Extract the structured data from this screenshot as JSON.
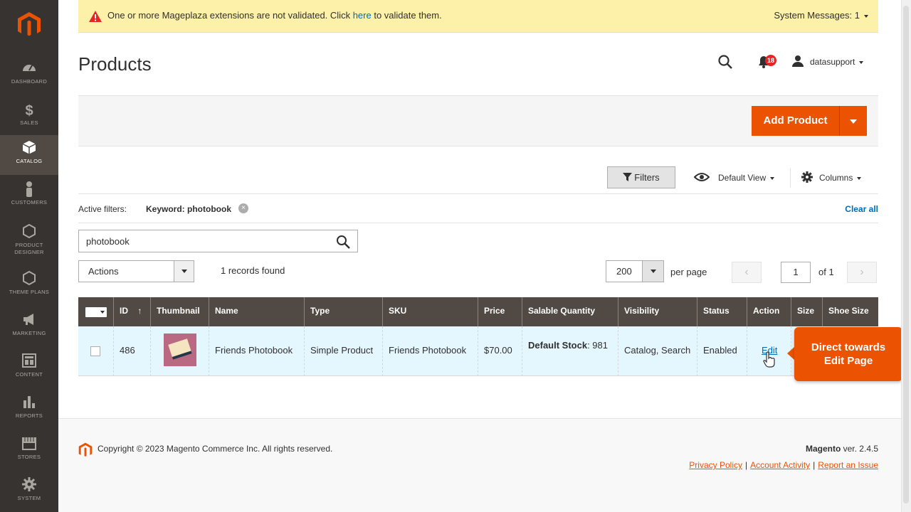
{
  "sidebar": {
    "items": [
      {
        "label": "Dashboard",
        "icon": "dashboard-icon"
      },
      {
        "label": "Sales",
        "icon": "dollar-icon"
      },
      {
        "label": "Catalog",
        "icon": "box-icon"
      },
      {
        "label": "Customers",
        "icon": "person-icon"
      },
      {
        "label": "Product Designer",
        "icon": "hexagon-icon"
      },
      {
        "label": "Theme Plans",
        "icon": "hexagon-icon"
      },
      {
        "label": "Marketing",
        "icon": "megaphone-icon"
      },
      {
        "label": "Content",
        "icon": "layout-icon"
      },
      {
        "label": "Reports",
        "icon": "bar-chart-icon"
      },
      {
        "label": "Stores",
        "icon": "store-icon"
      },
      {
        "label": "System",
        "icon": "gear-icon"
      }
    ],
    "active": "Catalog"
  },
  "system_message": {
    "text_before": "One or more Mageplaza extensions are not validated. Click ",
    "link": "here",
    "text_after": " to validate them.",
    "counter": "System Messages: 1"
  },
  "header": {
    "title": "Products",
    "notifications_count": "18",
    "user": "datasupport"
  },
  "actions": {
    "add_product": "Add Product"
  },
  "toolbar": {
    "filters": "Filters",
    "view": "Default View",
    "columns": "Columns"
  },
  "active_filters": {
    "label": "Active filters:",
    "chip": "Keyword: photobook",
    "remove": "×",
    "clear_all": "Clear all"
  },
  "search": {
    "value": "photobook"
  },
  "mass_actions": "Actions",
  "records_found": "1 records found",
  "pagination": {
    "per_page_value": "200",
    "per_page_label": "per page",
    "prev": "‹",
    "next": "›",
    "current_page": "1",
    "total_pages": "of 1"
  },
  "grid": {
    "columns": [
      "ID",
      "Thumbnail",
      "Name",
      "Type",
      "SKU",
      "Price",
      "Salable Quantity",
      "Visibility",
      "Status",
      "Action",
      "Size",
      "Shoe Size"
    ],
    "sort_indicator": "↑",
    "row": {
      "id": "486",
      "name": "Friends Photobook",
      "type": "Simple Product",
      "sku": "Friends Photobook",
      "price": "$70.00",
      "salable_label": "Default Stock",
      "salable_value": ": 981",
      "visibility": "Catalog, Search",
      "status": "Enabled",
      "action": "Edit",
      "size": "",
      "shoe_size": ""
    }
  },
  "tooltip": {
    "line1": "Direct towards",
    "line2": "Edit Page"
  },
  "footer": {
    "copyright": "Copyright © 2023 Magento Commerce Inc. All rights reserved.",
    "brand": "Magento",
    "version": " ver. 2.4.5",
    "links": [
      "Privacy Policy",
      "Account Activity",
      "Report an Issue"
    ]
  },
  "colors": {
    "accent": "#eb5202",
    "sidebar": "#373330",
    "grid_header": "#514943",
    "link": "#006bb4",
    "message_bg": "#fdf0a9"
  }
}
